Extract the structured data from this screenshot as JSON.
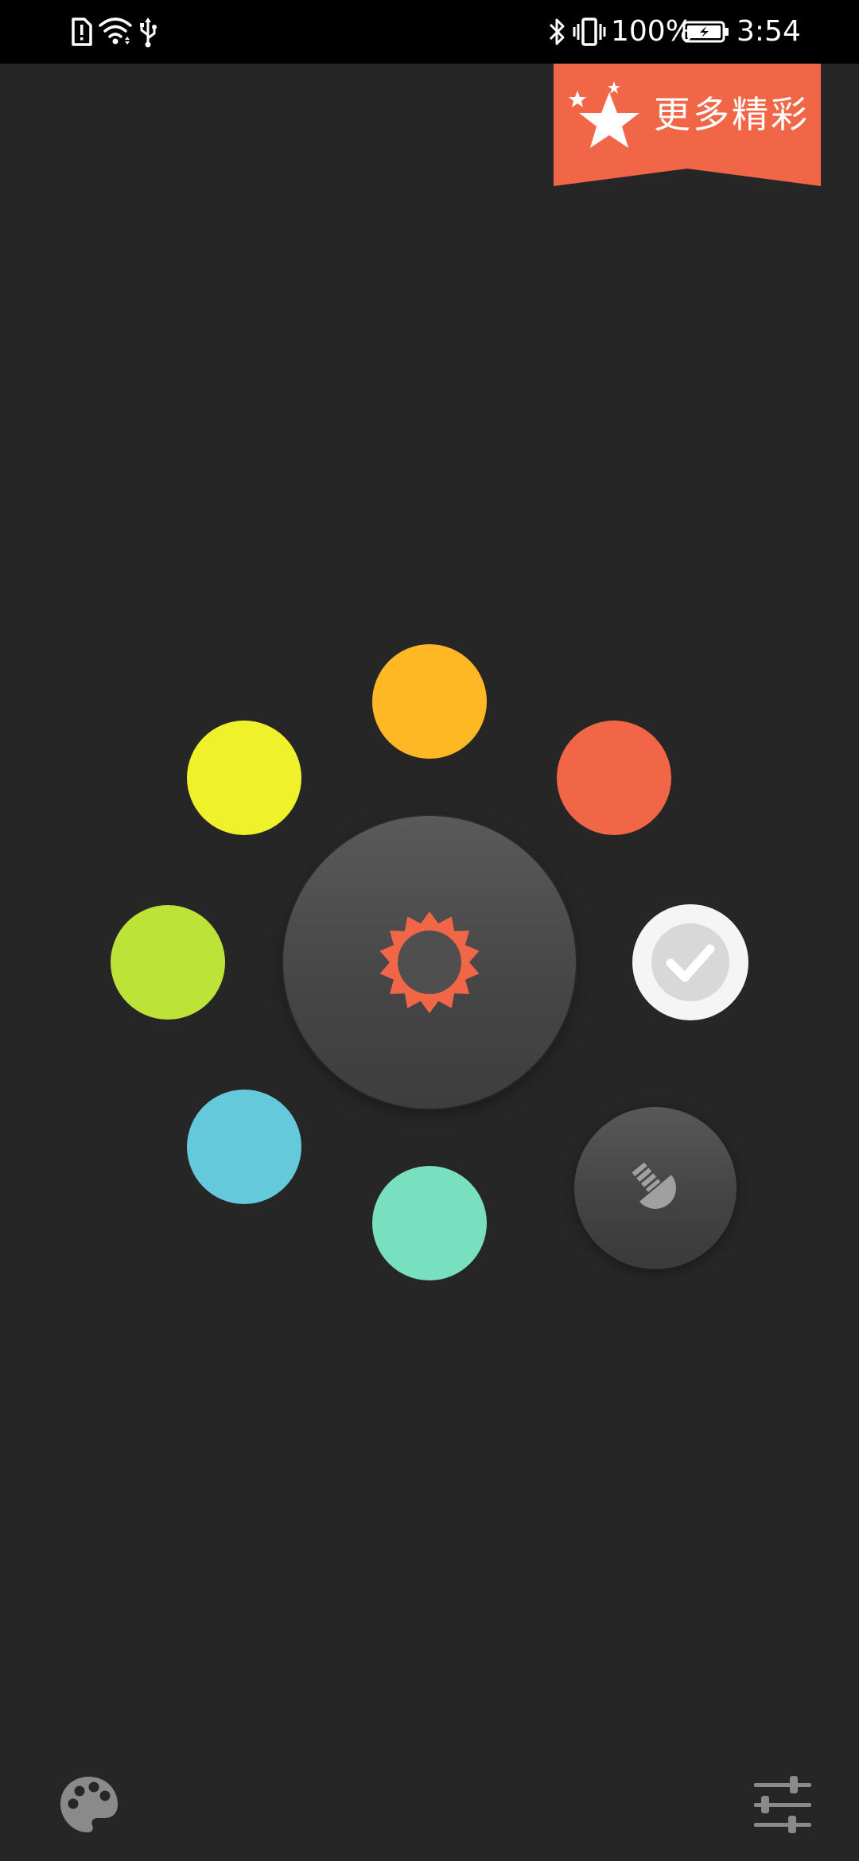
{
  "status_bar": {
    "icons_left": [
      "sim-alert-icon",
      "wifi-icon",
      "usb-icon"
    ],
    "icons_right": [
      "bluetooth-icon",
      "vibrate-icon",
      "battery-charging-icon"
    ],
    "battery_text": "100%",
    "time": "3:54"
  },
  "promo": {
    "label": "更多精彩",
    "icon": "stars-icon",
    "color": "#f26648"
  },
  "color_wheel": {
    "swatches": [
      {
        "name": "orange",
        "color": "#fdb824"
      },
      {
        "name": "red-orange",
        "color": "#f26648"
      },
      {
        "name": "white",
        "color": "#f5f5f5",
        "selected": true
      },
      {
        "name": "yellow",
        "color": "#eff12a"
      },
      {
        "name": "lime",
        "color": "#bde338"
      },
      {
        "name": "sky-blue",
        "color": "#64cadb"
      },
      {
        "name": "mint",
        "color": "#79e0bf"
      }
    ],
    "center_icon": "sun-icon",
    "center_icon_color": "#f26648",
    "selected_icon": "check-icon",
    "flashlight_icon": "flashlight-icon"
  },
  "bottom_bar": {
    "left_icon": "palette-icon",
    "right_icon": "sliders-icon",
    "icon_color": "#8a8a8a"
  }
}
